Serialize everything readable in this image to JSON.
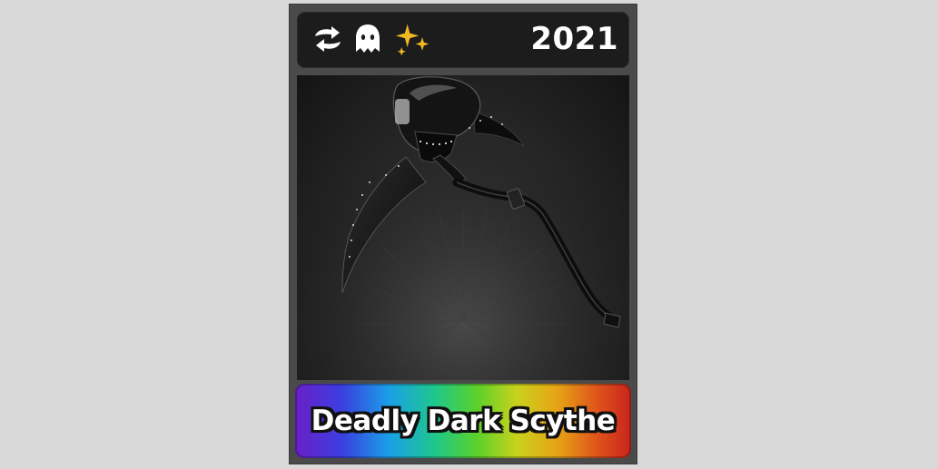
{
  "item": {
    "name": "Deadly Dark Scythe",
    "year": "2021",
    "badges": [
      {
        "icon": "trade-arrows-icon"
      },
      {
        "icon": "ghost-icon"
      },
      {
        "icon": "sparkle-icon"
      }
    ],
    "image": "scythe-icon"
  },
  "colors": {
    "background": "#d9d9d9",
    "card_frame": "#4a4a4a",
    "top_bar": "#1c1c1c",
    "sparkle": "#f2b824",
    "rainbow": [
      "#6a1fc7",
      "#3a3fe0",
      "#1aa0e8",
      "#1fc889",
      "#5ad12a",
      "#c9d21c",
      "#e6a415",
      "#e0531b",
      "#c9241c"
    ]
  }
}
